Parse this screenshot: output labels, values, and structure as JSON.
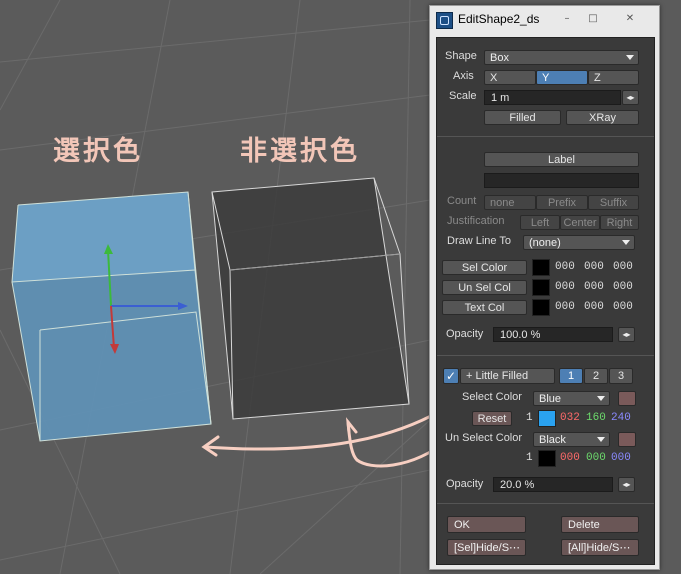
{
  "viewport": {
    "label_selected": "選択色",
    "label_unselected": "非選択色",
    "colors": {
      "background": "#5b5b5b",
      "sel_fill": "#5f93b9",
      "sel_wire": "#cfe0d9",
      "unsel_fill": "#3c3c3c",
      "annotation": "#f2c6b8"
    }
  },
  "window": {
    "title": "EditShape2_ds",
    "buttons": {
      "minimize": "–",
      "maximize": "□",
      "close": "✕"
    }
  },
  "shape": {
    "label": "Shape",
    "value": "Box",
    "axis_label": "Axis",
    "axes": [
      "X",
      "Y",
      "Z"
    ],
    "axis_selected": "Y",
    "scale_label": "Scale",
    "scale_value": "1 m",
    "filled_label": "Filled",
    "xray_label": "XRay"
  },
  "label_section": {
    "label_button": "Label",
    "count_label": "Count",
    "count_options": [
      "none",
      "Prefix",
      "Suffix"
    ],
    "justification_label": "Justification",
    "justification_options": [
      "Left",
      "Center",
      "Right"
    ],
    "draw_line_label": "Draw Line To",
    "draw_line_value": "(none)",
    "color_rows": [
      {
        "label": "Sel Color",
        "values": [
          "000",
          "000",
          "000"
        ]
      },
      {
        "label": "Un Sel Col",
        "values": [
          "000",
          "000",
          "000"
        ]
      },
      {
        "label": "Text Col",
        "values": [
          "000",
          "000",
          "000"
        ]
      }
    ],
    "opacity_label": "Opacity",
    "opacity_value": "100.0 %"
  },
  "fill_section": {
    "little_filled_label": "+ Little Filled",
    "tabs": [
      "1",
      "2",
      "3"
    ],
    "tab_selected": "1",
    "select_color_label": "Select Color",
    "select_color_value": "Blue",
    "reset_label": "Reset",
    "select_index": "1",
    "select_rgb": [
      "032",
      "160",
      "240"
    ],
    "select_swatch": "#2aa2f0",
    "unselect_color_label": "Un Select Color",
    "unselect_color_value": "Black",
    "unselect_index": "1",
    "unselect_rgb": [
      "000",
      "000",
      "000"
    ],
    "unselect_swatch": "#000000",
    "opacity_label": "Opacity",
    "opacity_value": "20.0 %"
  },
  "footer": {
    "ok_label": "OK",
    "delete_label": "Delete",
    "sel_hide_label": "[Sel]Hide/S⋯",
    "all_hide_label": "[All]Hide/S⋯"
  }
}
